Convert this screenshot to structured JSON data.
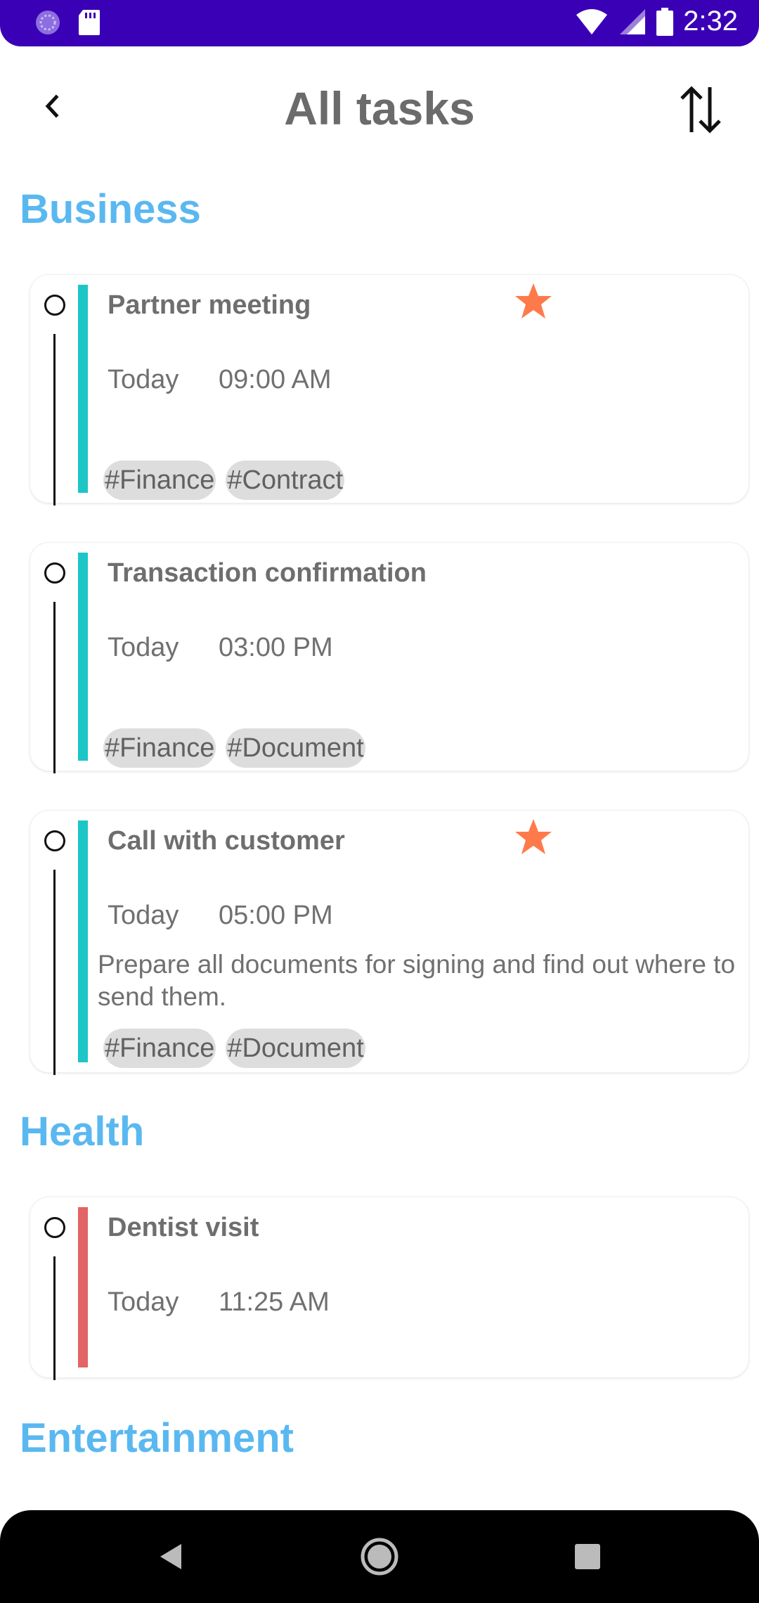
{
  "status_bar": {
    "time": "2:32"
  },
  "app_bar": {
    "title": "All tasks"
  },
  "sections": [
    {
      "title": "Business",
      "tasks": [
        {
          "title": "Partner meeting",
          "starred": true,
          "date": "Today",
          "time": "09:00 AM",
          "description": "",
          "tags": [
            "#Finance",
            "#Contract"
          ],
          "color": "#1cc6c6"
        },
        {
          "title": "Transaction confirmation",
          "starred": false,
          "date": "Today",
          "time": "03:00 PM",
          "description": "",
          "tags": [
            "#Finance",
            "#Document"
          ],
          "color": "#1cc6c6"
        },
        {
          "title": "Call with customer",
          "starred": true,
          "date": "Today",
          "time": "05:00 PM",
          "description": "Prepare all documents for signing and find out where to send them.",
          "tags": [
            "#Finance",
            "#Document"
          ],
          "color": "#1cc6c6"
        }
      ]
    },
    {
      "title": "Health",
      "tasks": [
        {
          "title": "Dentist visit",
          "starred": false,
          "date": "Today",
          "time": "11:25 AM",
          "description": "",
          "tags": [],
          "color": "#e26464"
        }
      ]
    },
    {
      "title": "Entertainment",
      "tasks": []
    }
  ],
  "colors": {
    "accent_title": "#5ab8f0",
    "status_bar": "#3a00b5",
    "star": "#ff7a4a"
  },
  "icons": {
    "back": "chevron-left-icon",
    "sort": "sort-arrows-icon",
    "star": "star-icon"
  }
}
